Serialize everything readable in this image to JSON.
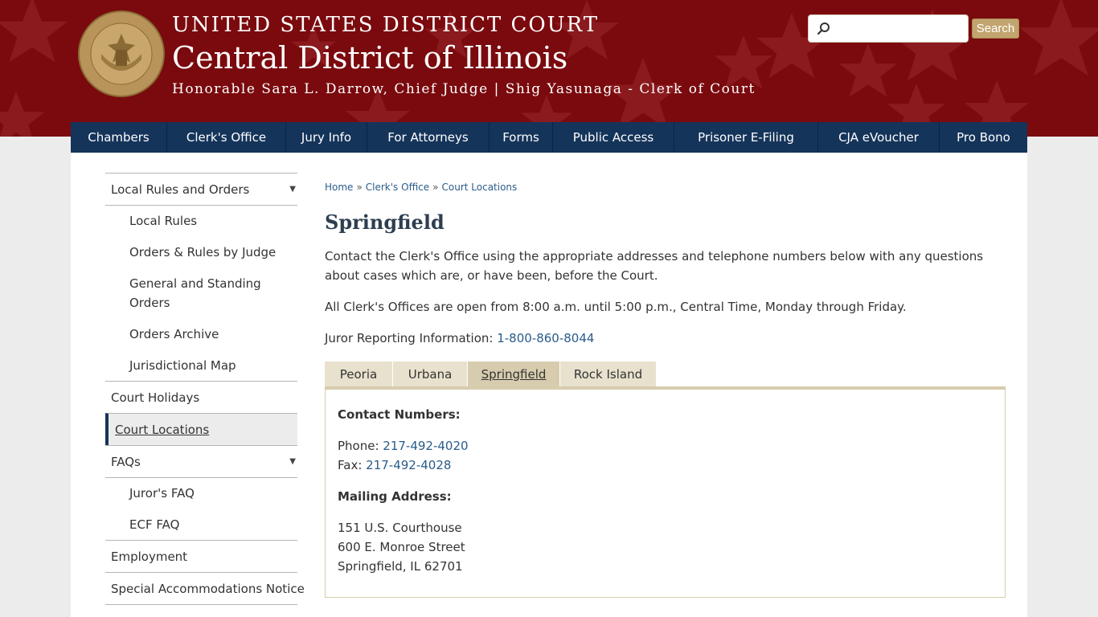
{
  "header": {
    "line1": "UNITED STATES DISTRICT COURT",
    "line2": "Central District of Illinois",
    "line3": "Honorable Sara L. Darrow, Chief Judge | Shig Yasunaga - Clerk of Court",
    "seal_text": "CENTRAL DISTRICT OF ILLINOIS",
    "seal_text_top": "UNITED STATES DISTRICT COURT",
    "bg_color": "#7a0a0e"
  },
  "search": {
    "placeholder": "",
    "button_label": "Search"
  },
  "nav": {
    "items": [
      "Chambers",
      "Clerk's Office",
      "Jury Info",
      "For Attorneys",
      "Forms",
      "Public Access",
      "Prisoner E-Filing",
      "CJA eVoucher",
      "Pro Bono"
    ]
  },
  "sidebar": {
    "local_rules_and_orders": "Local Rules and Orders",
    "local_rules": "Local Rules",
    "orders_rules_by_judge": "Orders & Rules by Judge",
    "general_standing_orders": "General and Standing Orders",
    "orders_archive": "Orders Archive",
    "jurisdictional_map": "Jurisdictional Map",
    "court_holidays": "Court Holidays",
    "court_locations": "Court Locations",
    "faqs": "FAQs",
    "jurors_faq": "Juror's FAQ",
    "ecf_faq": "ECF FAQ",
    "employment": "Employment",
    "special_accommodations": "Special Accommodations Notice"
  },
  "breadcrumb": {
    "home": "Home",
    "clerks_office": "Clerk's Office",
    "court_locations": "Court Locations",
    "separator": "»"
  },
  "page": {
    "title": "Springfield",
    "intro": "Contact the Clerk's Office using the appropriate addresses and telephone numbers below with any questions about cases which are, or have been, before the Court.",
    "hours": "All Clerk's Offices are open from 8:00 a.m. until 5:00 p.m., Central Time, Monday through Friday.",
    "juror_label": "Juror Reporting Information: ",
    "juror_phone": "1-800-860-8044"
  },
  "tabs": {
    "items": [
      "Peoria",
      "Urbana",
      "Springfield",
      "Rock Island"
    ],
    "active": "Springfield"
  },
  "contact": {
    "numbers_heading": "Contact Numbers:",
    "phone_label": "Phone: ",
    "phone": "217-492-4020",
    "fax_label": "Fax: ",
    "fax": "217-492-4028",
    "mailing_heading": "Mailing Address:",
    "address1": "151 U.S. Courthouse",
    "address2": "600 E. Monroe Street",
    "address3": "Springfield, IL 62701"
  }
}
